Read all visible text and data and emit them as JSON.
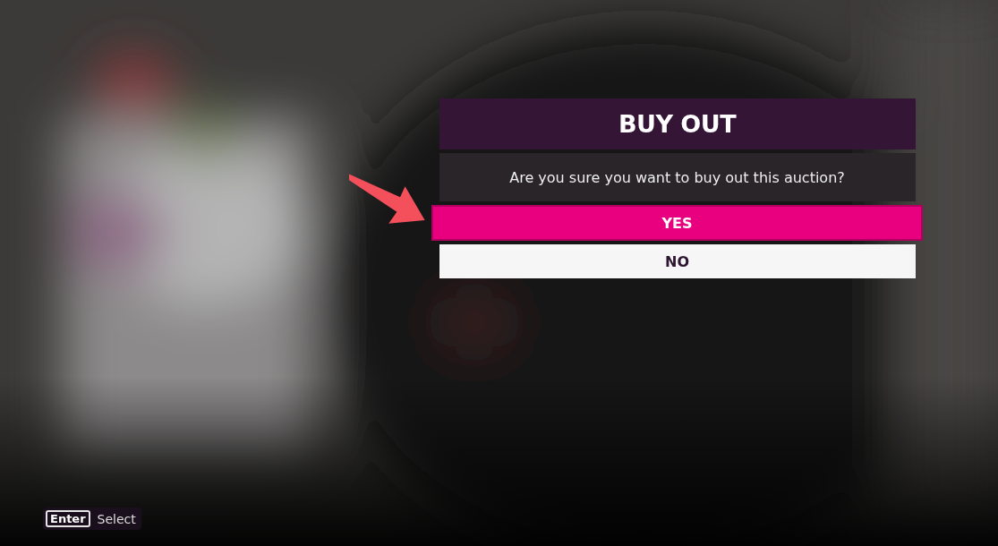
{
  "dialog": {
    "title": "BUY OUT",
    "message": "Are you sure you want to buy out this auction?",
    "options": [
      {
        "label": "YES",
        "selected": true
      },
      {
        "label": "NO",
        "selected": false
      }
    ]
  },
  "hints": [
    {
      "key": "Enter",
      "label": "Select"
    }
  ]
}
